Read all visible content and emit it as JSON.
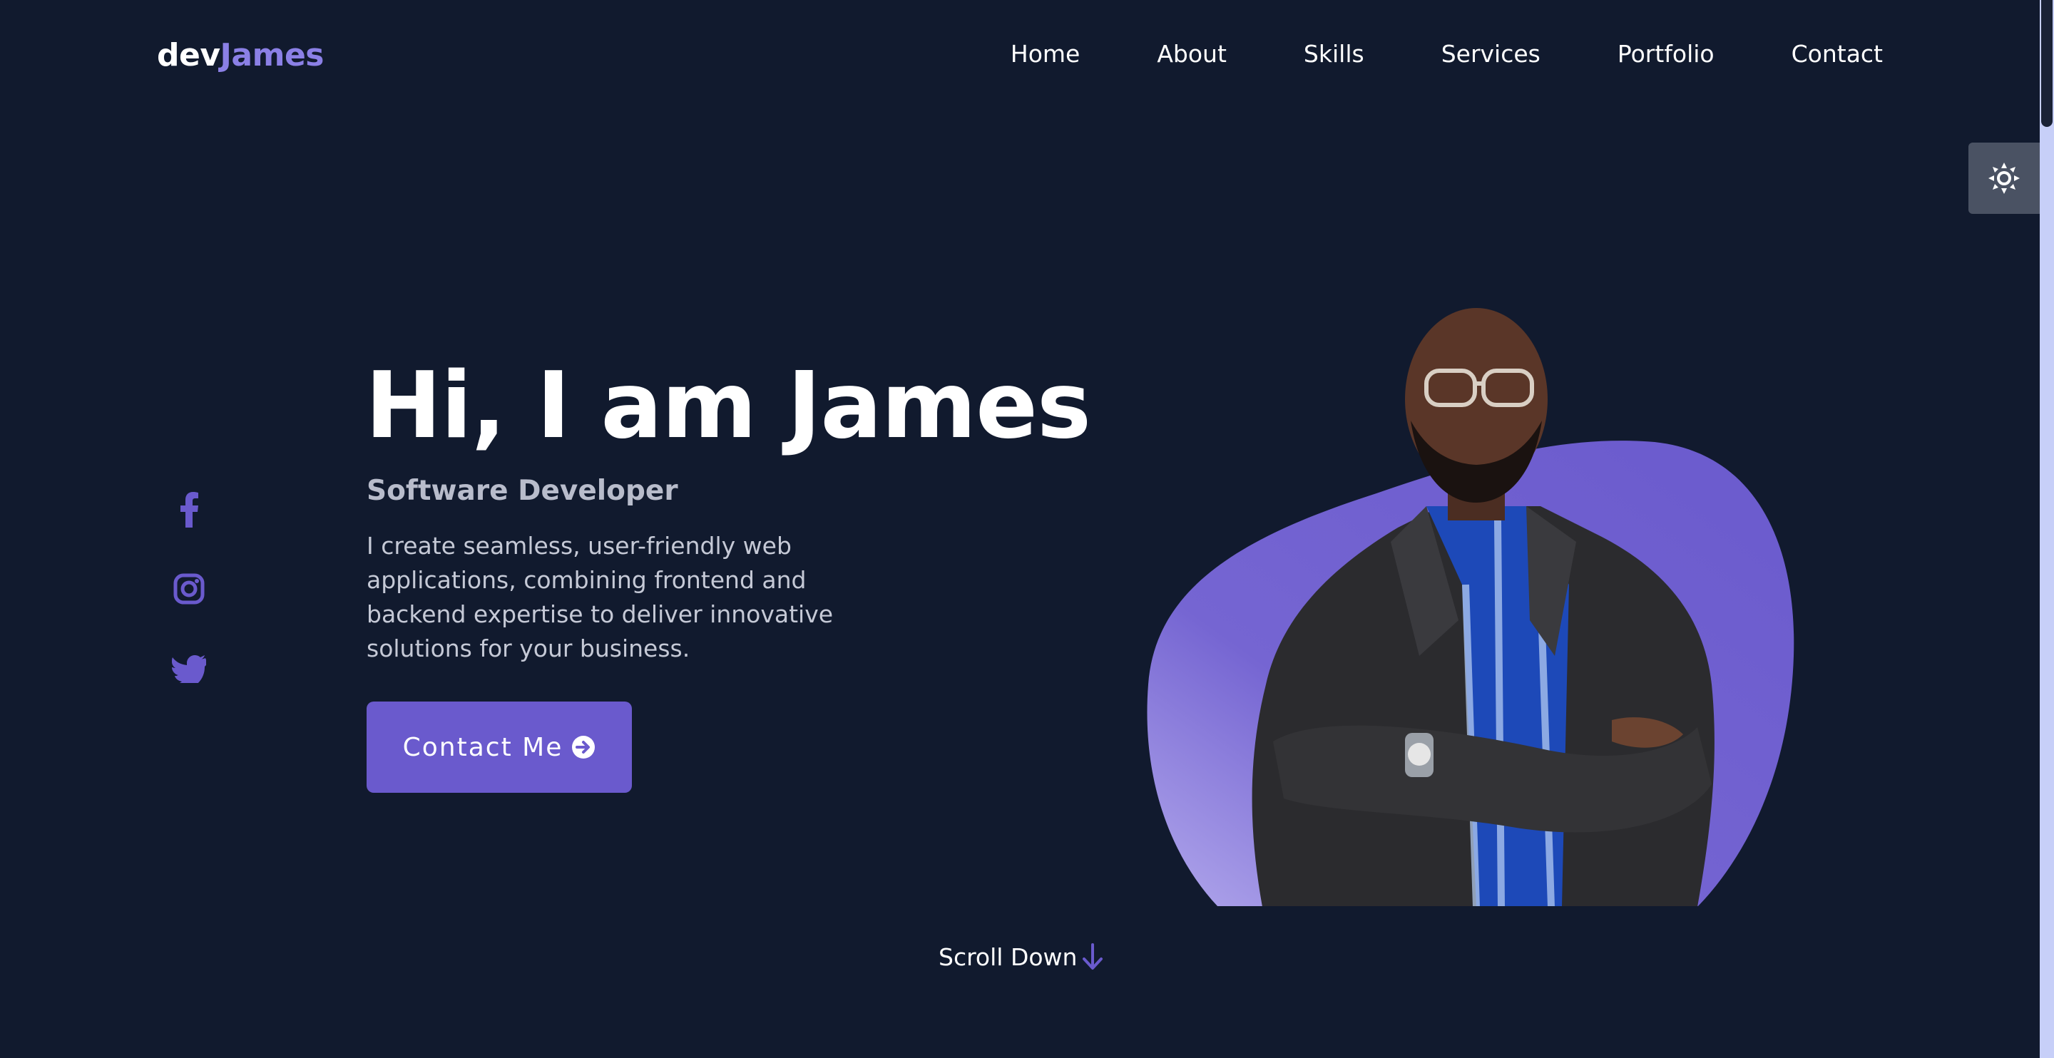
{
  "header": {
    "logo_prefix": "dev",
    "logo_accent": "James",
    "nav": [
      {
        "label": "Home"
      },
      {
        "label": "About"
      },
      {
        "label": "Skills"
      },
      {
        "label": "Services"
      },
      {
        "label": "Portfolio"
      },
      {
        "label": "Contact"
      }
    ]
  },
  "theme_toggle": {
    "icon": "sun-icon"
  },
  "socials": [
    {
      "icon": "facebook-icon"
    },
    {
      "icon": "instagram-icon"
    },
    {
      "icon": "twitter-icon"
    }
  ],
  "hero": {
    "title": "Hi, I am James",
    "subtitle": "Software Developer",
    "description": "I create seamless, user-friendly web applications, combining frontend and backend expertise to deliver innovative solutions for your business.",
    "cta_label": "Contact Me",
    "cta_icon": "arrow-circle-right-icon"
  },
  "scroll_down": {
    "label": "Scroll Down",
    "icon": "arrow-down-icon"
  },
  "colors": {
    "background": "#111a2e",
    "accent": "#6a5acd",
    "accent_light": "#8b80e6",
    "toggle_bg": "#4a5263"
  }
}
